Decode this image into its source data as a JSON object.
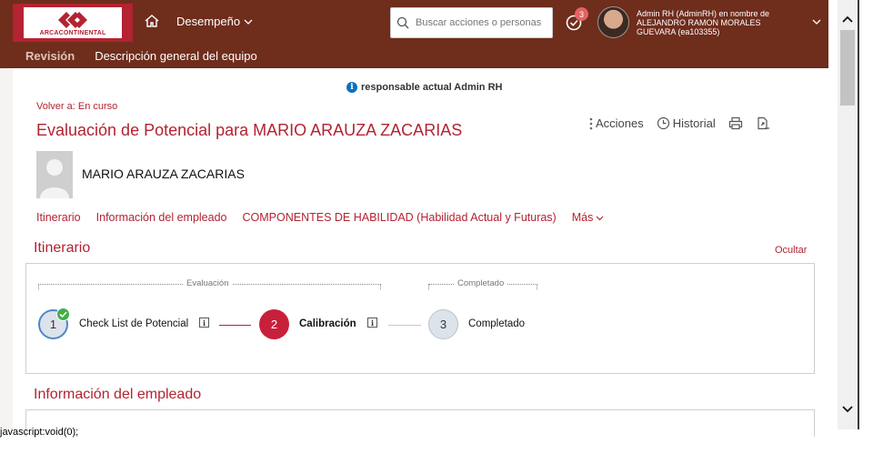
{
  "brand": {
    "logo_text": "ARCACONTINENTAL",
    "primary": "#6f2d1c",
    "accent": "#b32331"
  },
  "header": {
    "module_label": "Desempeño",
    "search_placeholder": "Buscar acciones o personas",
    "todo_count": "3",
    "proxy_text": "Admin RH (AdminRH) en nombre de ALEJANDRO RAMON MORALES GUEVARA (ea103355)"
  },
  "subnav": {
    "revision": "Revisión",
    "team": "Descripción general del equipo"
  },
  "document": {
    "owner_note": "responsable actual Admin RH",
    "back_link": "Volver a: En curso",
    "title": "Evaluación de Potencial para MARIO ARAUZA ZACARIAS",
    "actions_label": "Acciones",
    "history_label": "Historial",
    "employee_name": "MARIO ARAUZA ZACARIAS"
  },
  "sections_nav": {
    "route": "Itinerario",
    "employee_info": "Información del empleado",
    "skills": "COMPONENTES DE HABILIDAD (Habilidad Actual y Futuras)",
    "more": "Más"
  },
  "route": {
    "title": "Itinerario",
    "hide": "Ocultar",
    "phase_evaluation": "Evaluación",
    "phase_completed": "Completado",
    "steps": [
      {
        "number": "1",
        "label": "Check List de Potencial",
        "state": "done"
      },
      {
        "number": "2",
        "label": "Calibración",
        "state": "current"
      },
      {
        "number": "3",
        "label": "Completado",
        "state": "pending"
      }
    ]
  },
  "employee_section": {
    "title": "Información del empleado"
  },
  "status_bar": "javascript:void(0);"
}
